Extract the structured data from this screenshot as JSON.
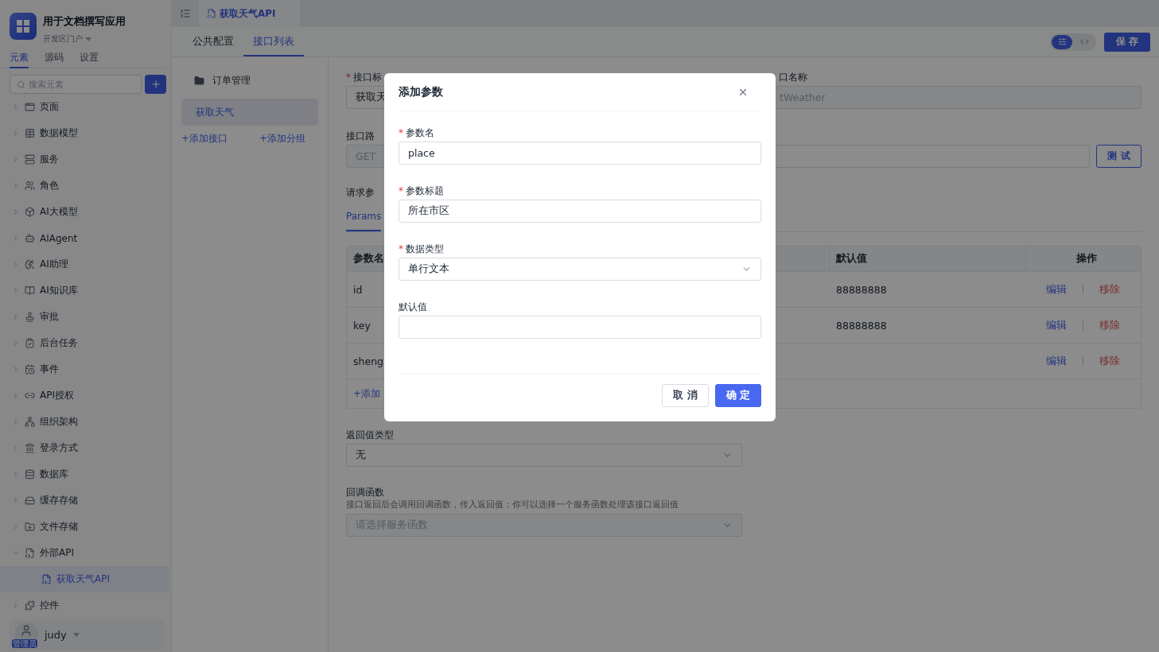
{
  "app": {
    "title": "用于文档撰写应用",
    "subtitle": "开发区门户"
  },
  "required_mark": "*",
  "sidebar_tabs": [
    {
      "label": "元素",
      "selected": true
    },
    {
      "label": "源码",
      "selected": false
    },
    {
      "label": "设置",
      "selected": false
    }
  ],
  "search": {
    "placeholder": "搜索元素"
  },
  "tree": [
    {
      "label": "页面",
      "kind": "page",
      "expanded": false,
      "selected": false
    },
    {
      "label": "数据模型",
      "kind": "table",
      "expanded": false,
      "selected": false
    },
    {
      "label": "服务",
      "kind": "service",
      "expanded": false,
      "selected": false
    },
    {
      "label": "角色",
      "kind": "role",
      "expanded": false,
      "selected": false
    },
    {
      "label": "AI大模型",
      "kind": "model",
      "expanded": false,
      "selected": false
    },
    {
      "label": "AIAgent",
      "kind": "agent",
      "expanded": false,
      "selected": false
    },
    {
      "label": "AI助理",
      "kind": "assistant",
      "expanded": false,
      "selected": false
    },
    {
      "label": "AI知识库",
      "kind": "knowledge",
      "expanded": false,
      "selected": false
    },
    {
      "label": "审批",
      "kind": "approval",
      "expanded": false,
      "selected": false
    },
    {
      "label": "后台任务",
      "kind": "task",
      "expanded": false,
      "selected": false
    },
    {
      "label": "事件",
      "kind": "event",
      "expanded": false,
      "selected": false
    },
    {
      "label": "API授权",
      "kind": "auth",
      "expanded": false,
      "selected": false
    },
    {
      "label": "组织架构",
      "kind": "org",
      "expanded": false,
      "selected": false
    },
    {
      "label": "登录方式",
      "kind": "login",
      "expanded": false,
      "selected": false
    },
    {
      "label": "数据库",
      "kind": "database",
      "expanded": false,
      "selected": false
    },
    {
      "label": "缓存存储",
      "kind": "cache",
      "expanded": false,
      "selected": false
    },
    {
      "label": "文件存储",
      "kind": "file",
      "expanded": false,
      "selected": false
    },
    {
      "label": "外部API",
      "kind": "api",
      "expanded": true,
      "selected": false,
      "children": [
        {
          "label": "获取天气API",
          "kind": "api",
          "selected": true
        }
      ]
    },
    {
      "label": "控件",
      "kind": "widget",
      "expanded": false,
      "selected": false
    }
  ],
  "user": {
    "name": "judy",
    "badge": "管理员"
  },
  "doc_tabs": [
    {
      "label": "获取天气API",
      "selected": true
    }
  ],
  "sub_tabs": [
    {
      "label": "公共配置",
      "selected": false
    },
    {
      "label": "接口列表",
      "selected": true
    }
  ],
  "view_toggle": [
    {
      "kind": "sliders",
      "selected": true
    },
    {
      "kind": "code",
      "selected": false
    }
  ],
  "save_button": "保 存",
  "api_list": {
    "groups": [
      {
        "label": "订单管理"
      }
    ],
    "items": [
      {
        "label": "获取天气",
        "selected": true
      }
    ],
    "actions": [
      "+添加接口",
      "+添加分组"
    ]
  },
  "form": {
    "title_label": "接口标",
    "title_required": true,
    "title_value": "获取天",
    "name_label": "口名称",
    "name_value": "tWeather",
    "path_label": "接口路",
    "method": "GET",
    "test_button": "测 试",
    "params_label": "请求参",
    "param_tabs": [
      {
        "label": "Params",
        "selected": true
      }
    ],
    "table": {
      "columns": [
        "参数名",
        "默认值",
        "操作"
      ],
      "rows": [
        {
          "name": "id",
          "default": "88888888",
          "actions": [
            "编辑",
            "移除"
          ]
        },
        {
          "name": "key",
          "default": "88888888",
          "actions": [
            "编辑",
            "移除"
          ]
        },
        {
          "name": "sheng",
          "actions": [
            "编辑",
            "移除"
          ]
        }
      ],
      "add": "+添加"
    },
    "return_label": "返回值类型",
    "return_value": "无",
    "callback_label": "回调函数",
    "callback_hint": "接口返回后会调用回调函数，传入返回值；你可以选择一个服务函数处理该接口返回值",
    "callback_placeholder": "请选择服务函数"
  },
  "modal": {
    "title": "添加参数",
    "fields": [
      {
        "label": "参数名",
        "required": true,
        "kind": "input",
        "value": "place"
      },
      {
        "label": "参数标题",
        "required": true,
        "kind": "input",
        "value": "所在市区"
      },
      {
        "label": "数据类型",
        "required": true,
        "kind": "select",
        "value": "单行文本"
      },
      {
        "label": "默认值",
        "required": false,
        "kind": "input"
      }
    ],
    "buttons": [
      {
        "label": "取 消",
        "kind": "default"
      },
      {
        "label": "确 定",
        "kind": "primary"
      }
    ]
  }
}
